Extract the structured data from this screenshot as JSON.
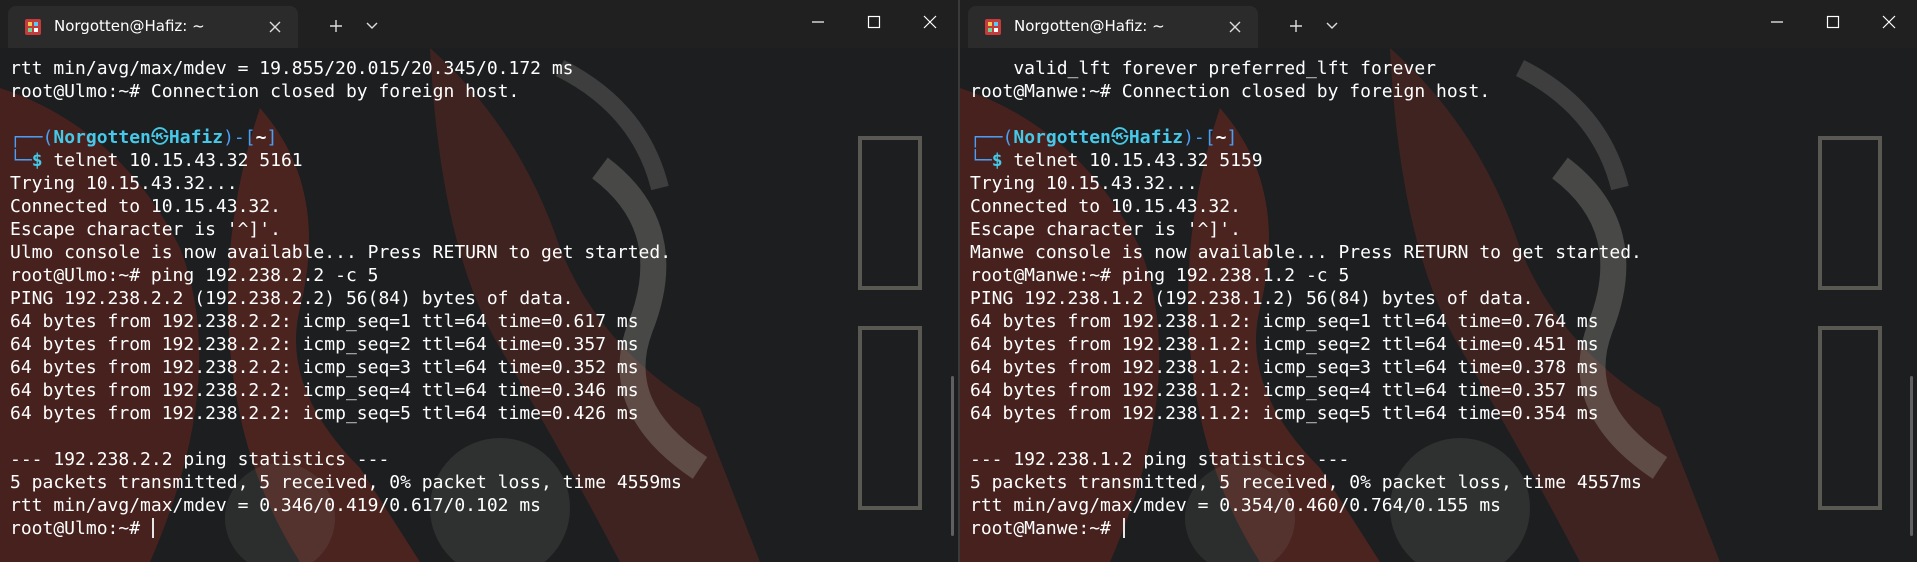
{
  "windows": {
    "left": {
      "tab_title": "Norgotten@Hafiz: ~",
      "lines": [
        "rtt min/avg/max/mdev = 19.855/20.015/20.345/0.172 ms",
        "root@Ulmo:~# Connection closed by foreign host.",
        "",
        "PROMPT1",
        "PROMPT2",
        "Trying 10.15.43.32...",
        "Connected to 10.15.43.32.",
        "Escape character is '^]'.",
        "Ulmo console is now available... Press RETURN to get started.",
        "root@Ulmo:~# ping 192.238.2.2 -c 5",
        "PING 192.238.2.2 (192.238.2.2) 56(84) bytes of data.",
        "64 bytes from 192.238.2.2: icmp_seq=1 ttl=64 time=0.617 ms",
        "64 bytes from 192.238.2.2: icmp_seq=2 ttl=64 time=0.357 ms",
        "64 bytes from 192.238.2.2: icmp_seq=3 ttl=64 time=0.352 ms",
        "64 bytes from 192.238.2.2: icmp_seq=4 ttl=64 time=0.346 ms",
        "64 bytes from 192.238.2.2: icmp_seq=5 ttl=64 time=0.426 ms",
        "",
        "--- 192.238.2.2 ping statistics ---",
        "5 packets transmitted, 5 received, 0% packet loss, time 4559ms",
        "rtt min/avg/max/mdev = 0.346/0.419/0.617/0.102 ms",
        "root@Ulmo:~# "
      ],
      "prompt": {
        "open": "┌──(",
        "user": "Norgotten",
        "at": "㉿",
        "host": "Hafiz",
        "mid": ")-[",
        "dir": "~",
        "close": "]",
        "corner": "└─",
        "dollar": "$ ",
        "command": "telnet 10.15.43.32 5161"
      }
    },
    "right": {
      "tab_title": "Norgotten@Hafiz: ~",
      "lines": [
        "    valid_lft forever preferred_lft forever",
        "root@Manwe:~# Connection closed by foreign host.",
        "",
        "PROMPT1",
        "PROMPT2",
        "Trying 10.15.43.32...",
        "Connected to 10.15.43.32.",
        "Escape character is '^]'.",
        "Manwe console is now available... Press RETURN to get started.",
        "root@Manwe:~# ping 192.238.1.2 -c 5",
        "PING 192.238.1.2 (192.238.1.2) 56(84) bytes of data.",
        "64 bytes from 192.238.1.2: icmp_seq=1 ttl=64 time=0.764 ms",
        "64 bytes from 192.238.1.2: icmp_seq=2 ttl=64 time=0.451 ms",
        "64 bytes from 192.238.1.2: icmp_seq=3 ttl=64 time=0.378 ms",
        "64 bytes from 192.238.1.2: icmp_seq=4 ttl=64 time=0.357 ms",
        "64 bytes from 192.238.1.2: icmp_seq=5 ttl=64 time=0.354 ms",
        "",
        "--- 192.238.1.2 ping statistics ---",
        "5 packets transmitted, 5 received, 0% packet loss, time 4557ms",
        "rtt min/avg/max/mdev = 0.354/0.460/0.764/0.155 ms",
        "root@Manwe:~# "
      ],
      "prompt": {
        "open": "┌──(",
        "user": "Norgotten",
        "at": "㉿",
        "host": "Hafiz",
        "mid": ")-[",
        "dir": "~",
        "close": "]",
        "corner": "└─",
        "dollar": "$ ",
        "command": "telnet 10.15.43.32 5159"
      }
    }
  },
  "icons": {
    "app": "terminal-app-icon",
    "tab_close": "close-icon",
    "new_tab": "plus-icon",
    "dropdown": "chevron-down-icon",
    "minimize": "minimize-icon",
    "maximize": "maximize-icon",
    "close": "close-icon"
  },
  "colors": {
    "titlebar": "#202020",
    "tab_active": "#2b2b2b",
    "terminal_bg": "#1b1d1f",
    "prompt_blue": "#4a9ff6",
    "prompt_cyan": "#46c8e8",
    "text": "#ffffff"
  }
}
